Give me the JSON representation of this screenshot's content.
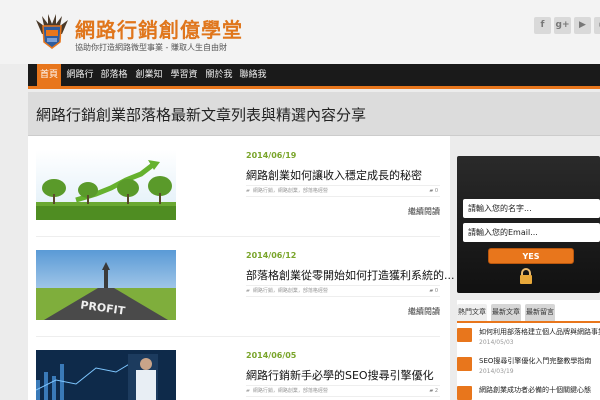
{
  "header": {
    "site_title": "網路行銷創億學堂",
    "tagline": "協助你打造網路微型事業 - 賺取人生自由財",
    "social": [
      {
        "icon": "facebook-icon",
        "glyph": "f"
      },
      {
        "icon": "google-plus-icon",
        "glyph": "g+"
      },
      {
        "icon": "youtube-icon",
        "glyph": "▶"
      },
      {
        "icon": "rss-icon",
        "glyph": "◉"
      }
    ]
  },
  "nav": {
    "items": [
      "首頁",
      "網路行銷",
      "部落格學",
      "創業知識",
      "學習資源",
      "關於我們",
      "聯絡我們"
    ],
    "active_index": 0
  },
  "page_title": "網路行銷創業部落格最新文章列表與精選內容分享",
  "posts": [
    {
      "date": "2014/06/19",
      "title": "網路創業如何讓收入穩定成長的秘密",
      "category": "網路行銷，網路創業，部落格經營",
      "comments": "0",
      "read_more": "繼續閱讀",
      "thumb": "growth"
    },
    {
      "date": "2014/06/12",
      "title": "部落格創業從零開始如何打造獲利系統的...",
      "category": "網路行銷，網路創業，部落格經營",
      "comments": "0",
      "read_more": "繼續閱讀",
      "thumb": "profit"
    },
    {
      "date": "2014/06/05",
      "title": "網路行銷新手必學的SEO搜尋引擎優化",
      "category": "網路行銷，網路創業，部落格經營",
      "comments": "2",
      "read_more": "繼續閱讀",
      "thumb": "business"
    }
  ],
  "subscribe": {
    "name_placeholder": "請輸入您的名字...",
    "email_placeholder": "請輸入您的Email...",
    "button_label": "YES"
  },
  "widget": {
    "tabs": [
      "熱門文章",
      "最新文章",
      "最新留言"
    ],
    "active_tab": 0,
    "posts": [
      {
        "title": "如何利用部落格建立個人品牌與網路事業",
        "date": "2014/05/03"
      },
      {
        "title": "SEO搜尋引擎優化入門完整教學指南",
        "date": "2014/03/19"
      },
      {
        "title": "網路創業成功者必備的十個關鍵心態",
        "date": ""
      }
    ]
  },
  "colors": {
    "accent": "#e8761c",
    "date_green": "#7aa52b",
    "nav_bg": "#1a1a1a"
  }
}
